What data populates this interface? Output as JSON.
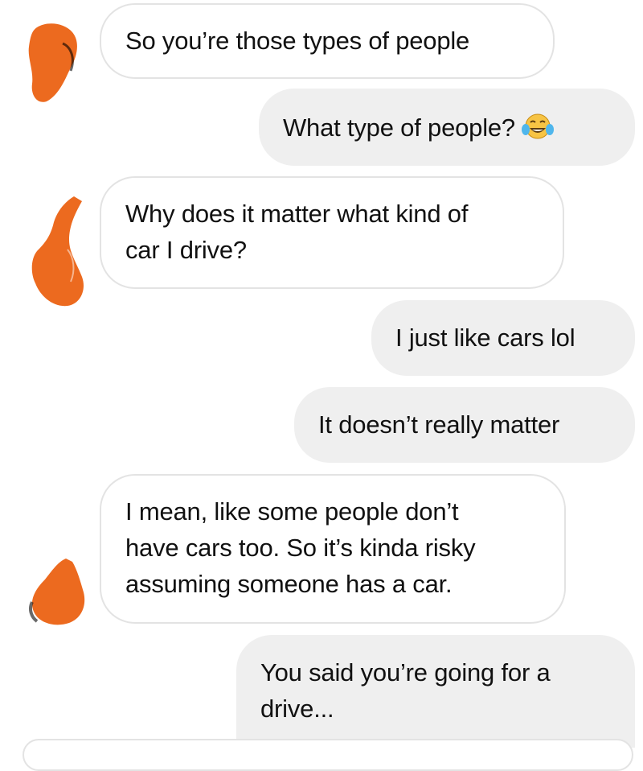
{
  "conversation": {
    "messages": [
      {
        "direction": "incoming",
        "lines": [
          "So you’re those types of people"
        ]
      },
      {
        "direction": "outgoing",
        "lines": [
          "What type of people?"
        ],
        "emoji": "face-with-tears-of-joy"
      },
      {
        "direction": "incoming",
        "lines": [
          "Why does it matter what kind of",
          "car I drive?"
        ]
      },
      {
        "direction": "outgoing",
        "lines": [
          "I just like cars lol"
        ]
      },
      {
        "direction": "outgoing",
        "lines": [
          "It doesn’t really matter"
        ]
      },
      {
        "direction": "incoming",
        "lines": [
          "I mean, like some people don’t",
          "have cars too. So it’s kinda risky",
          "assuming someone has a car."
        ]
      },
      {
        "direction": "outgoing",
        "lines": [
          "You said you’re going for a",
          "drive..."
        ]
      }
    ]
  },
  "colors": {
    "incoming_bg": "#ffffff",
    "incoming_border": "#e3e3e3",
    "outgoing_bg": "#efefef",
    "redaction": "#ec6a1f",
    "text": "#111111"
  },
  "icons": {
    "avatar": "redacted-avatar-icon",
    "emoji": "face-with-tears-of-joy-icon"
  }
}
